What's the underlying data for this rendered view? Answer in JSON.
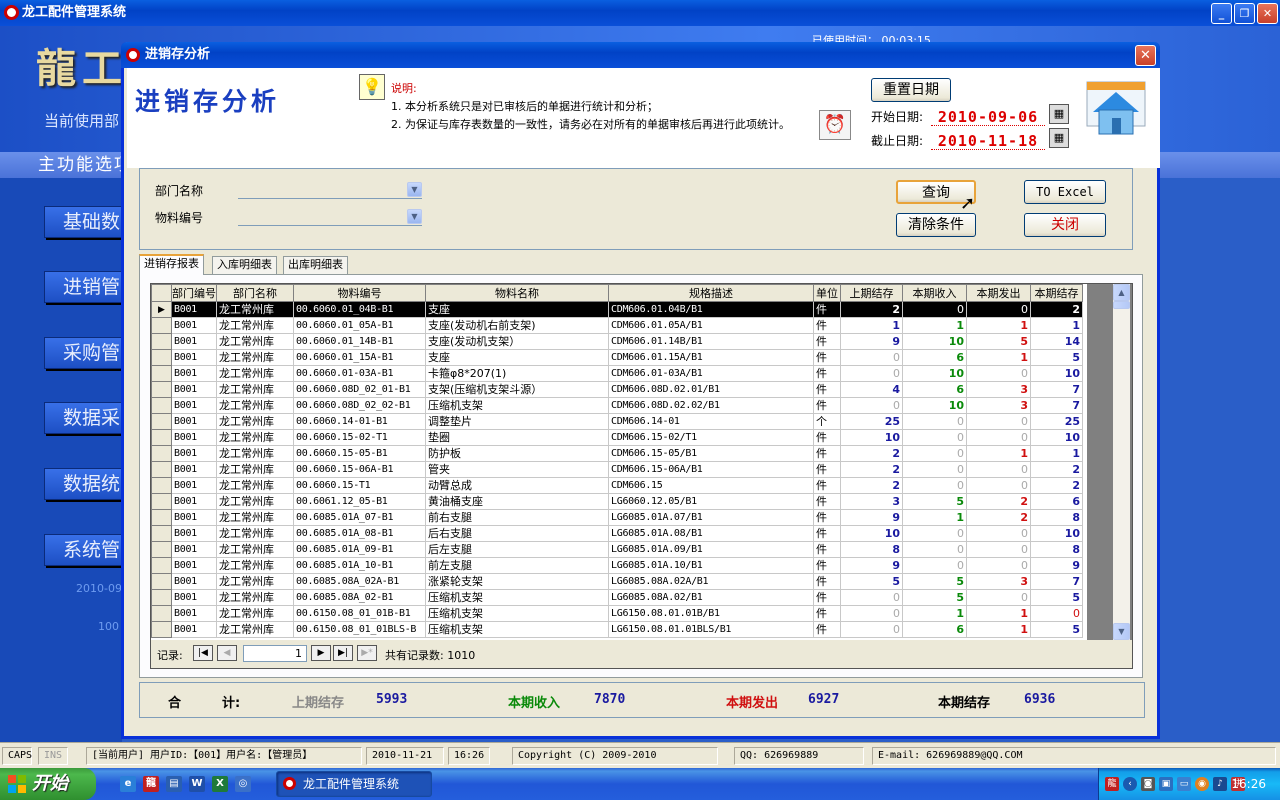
{
  "main": {
    "title": "龙工配件管理系统",
    "logo_text": "龍工",
    "current_user_label": "当前使用部",
    "use_time": "已使用时间：  00:03:15",
    "menu_title": "主功能选项",
    "nav": [
      "基础数",
      "进销管",
      "采购管",
      "数据采",
      "数据统",
      "系统管"
    ],
    "nav_small_1": "2010-09",
    "nav_small_2": "100"
  },
  "status": {
    "caps": "CAPS",
    "ins": "INS",
    "user": "[当前用户] 用户ID:【001】用户名:【管理员】",
    "date": "2010-11-21",
    "time": "16:26",
    "copyright": "Copyright  (C) 2009-2010",
    "qq": "QQ: 626969889",
    "email": "E-mail:  626969889@QQ.COM"
  },
  "dialog": {
    "title": "进销存分析",
    "big_title": "进销存分析",
    "note_title": "说明:",
    "note_1": "1. 本分析系统只是对已审核后的单据进行统计和分析；",
    "note_2": "2. 为保证与库存表数量的一致性，请务必在对所有的单据审核后再进行此项统计。",
    "reset_date": "重置日期",
    "start_label": "开始日期:",
    "start_date": "2010-09-06",
    "end_label": "截止日期:",
    "end_date": "2010-11-18"
  },
  "filters": {
    "dept_label": "部门名称",
    "dept_value": "",
    "part_label": "物料编号",
    "part_value": "",
    "query": "查询",
    "excel": "TO Excel",
    "clear": "清除条件",
    "close": "关闭"
  },
  "tabs": [
    "进销存报表",
    "入库明细表",
    "出库明细表"
  ],
  "grid": {
    "columns": [
      "部门编号",
      "部门名称",
      "物料编号",
      "物料名称",
      "规格描述",
      "单位",
      "上期结存",
      "本期收入",
      "本期发出",
      "本期结存"
    ],
    "rows": [
      [
        "B001",
        "龙工常州库",
        "00.6060.01_04B-B1",
        "支座",
        "CDM606.01.04B/B1",
        "件",
        2,
        0,
        0,
        2
      ],
      [
        "B001",
        "龙工常州库",
        "00.6060.01_05A-B1",
        "支座(发动机右前支架)",
        "CDM606.01.05A/B1",
        "件",
        1,
        1,
        1,
        1
      ],
      [
        "B001",
        "龙工常州库",
        "00.6060.01_14B-B1",
        "支座(发动机支架）",
        "CDM606.01.14B/B1",
        "件",
        9,
        10,
        5,
        14
      ],
      [
        "B001",
        "龙工常州库",
        "00.6060.01_15A-B1",
        "支座",
        "CDM606.01.15A/B1",
        "件",
        0,
        6,
        1,
        5
      ],
      [
        "B001",
        "龙工常州库",
        "00.6060.01-03A-B1",
        "卡箍φ8*207(1)",
        "CDM606.01-03A/B1",
        "件",
        0,
        10,
        0,
        10
      ],
      [
        "B001",
        "龙工常州库",
        "00.6060.08D_02_01-B1",
        "支架(压缩机支架斗源）",
        "CDM606.08D.02.01/B1",
        "件",
        4,
        6,
        3,
        7
      ],
      [
        "B001",
        "龙工常州库",
        "00.6060.08D_02_02-B1",
        "压缩机支架",
        "CDM606.08D.02.02/B1",
        "件",
        0,
        10,
        3,
        7
      ],
      [
        "B001",
        "龙工常州库",
        "00.6060.14-01-B1",
        "调整垫片",
        "CDM606.14-01",
        "个",
        25,
        0,
        0,
        25
      ],
      [
        "B001",
        "龙工常州库",
        "00.6060.15-02-T1",
        "垫圈",
        "CDM606.15-02/T1",
        "件",
        10,
        0,
        0,
        10
      ],
      [
        "B001",
        "龙工常州库",
        "00.6060.15-05-B1",
        "防护板",
        "CDM606.15-05/B1",
        "件",
        2,
        0,
        1,
        1
      ],
      [
        "B001",
        "龙工常州库",
        "00.6060.15-06A-B1",
        "管夹",
        "CDM606.15-06A/B1",
        "件",
        2,
        0,
        0,
        2
      ],
      [
        "B001",
        "龙工常州库",
        "00.6060.15-T1",
        "动臂总成",
        "CDM606.15",
        "件",
        2,
        0,
        0,
        2
      ],
      [
        "B001",
        "龙工常州库",
        "00.6061.12_05-B1",
        "黄油桶支座",
        "LG6060.12.05/B1",
        "件",
        3,
        5,
        2,
        6
      ],
      [
        "B001",
        "龙工常州库",
        "00.6085.01A_07-B1",
        "前右支腿",
        "LG6085.01A.07/B1",
        "件",
        9,
        1,
        2,
        8
      ],
      [
        "B001",
        "龙工常州库",
        "00.6085.01A_08-B1",
        "后右支腿",
        "LG6085.01A.08/B1",
        "件",
        10,
        0,
        0,
        10
      ],
      [
        "B001",
        "龙工常州库",
        "00.6085.01A_09-B1",
        "后左支腿",
        "LG6085.01A.09/B1",
        "件",
        8,
        0,
        0,
        8
      ],
      [
        "B001",
        "龙工常州库",
        "00.6085.01A_10-B1",
        "前左支腿",
        "LG6085.01A.10/B1",
        "件",
        9,
        0,
        0,
        9
      ],
      [
        "B001",
        "龙工常州库",
        "00.6085.08A_02A-B1",
        "涨紧轮支架",
        "LG6085.08A.02A/B1",
        "件",
        5,
        5,
        3,
        7
      ],
      [
        "B001",
        "龙工常州库",
        "00.6085.08A_02-B1",
        "压缩机支架",
        "LG6085.08A.02/B1",
        "件",
        0,
        5,
        0,
        5
      ],
      [
        "B001",
        "龙工常州库",
        "00.6150.08_01_01B-B1",
        "压缩机支架",
        "LG6150.08.01.01B/B1",
        "件",
        0,
        1,
        1,
        0
      ],
      [
        "B001",
        "龙工常州库",
        "00.6150.08_01_01BLS-B",
        "压缩机支架",
        "LG6150.08.01.01BLS/B1",
        "件",
        0,
        6,
        1,
        5
      ]
    ],
    "record_label": "记录:",
    "position": "1",
    "total_label": "共有记录数: 1010"
  },
  "totals": {
    "label_he": "合",
    "label_ji": "计:",
    "prev_label": "上期结存",
    "prev_value": "5993",
    "in_label": "本期收入",
    "in_value": "7870",
    "out_label": "本期发出",
    "out_value": "6927",
    "end_label": "本期结存",
    "end_value": "6936"
  },
  "taskbar": {
    "start": "开始",
    "task": "龙工配件管理系统",
    "clock": "16:26"
  },
  "colors": {
    "prev": "#1a1aa0",
    "in": "#0a8a0a",
    "out": "#d01010",
    "end": "#1a1aa0",
    "title_blue": "#0142c6"
  }
}
